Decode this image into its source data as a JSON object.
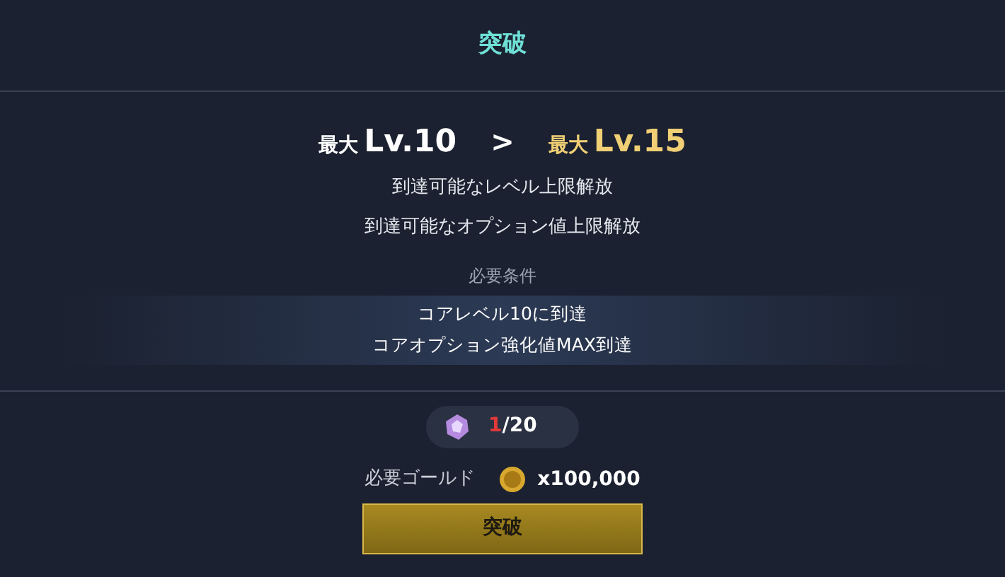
{
  "title": "突破",
  "levels": {
    "current_prefix": "最大",
    "current": "Lv.10",
    "arrow": ">",
    "next_prefix": "最大",
    "next": "Lv.15"
  },
  "effects": [
    "到達可能なレベル上限解放",
    "到達可能なオプション値上限解放"
  ],
  "requirements": {
    "heading": "必要条件",
    "items": [
      "コアレベル10に到達",
      "コアオプション強化値MAX到達"
    ]
  },
  "material": {
    "owned": "1",
    "required": "/20",
    "enough": false
  },
  "gold": {
    "label": "必要ゴールド",
    "amount": "x100,000"
  },
  "button": {
    "label": "突破",
    "disabled": false
  }
}
